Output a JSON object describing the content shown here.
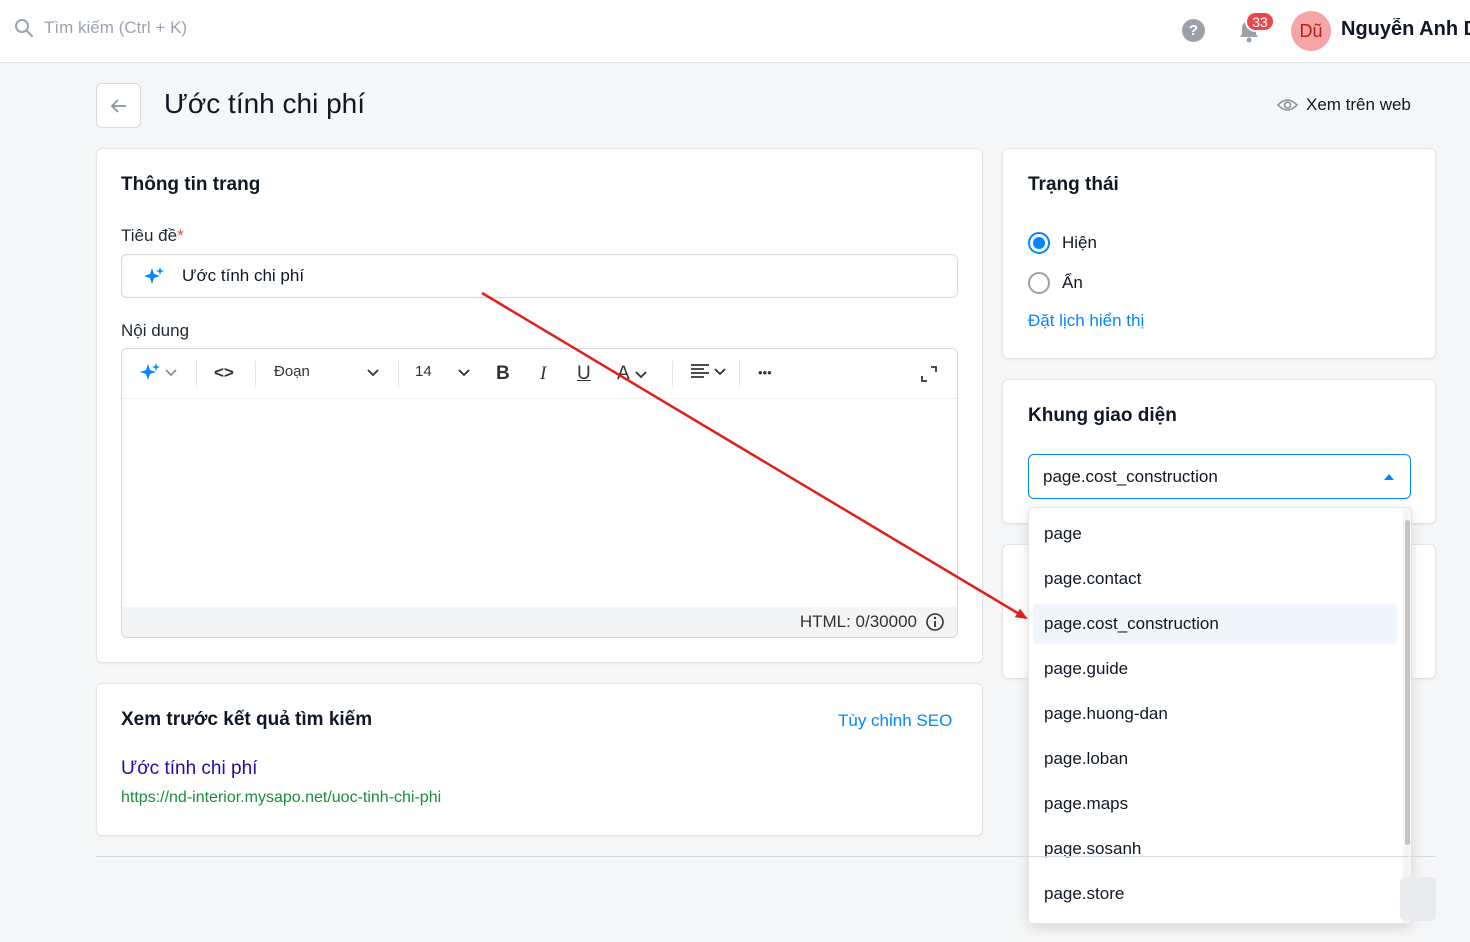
{
  "topbar": {
    "search_placeholder": "Tìm kiếm (Ctrl + K)",
    "help_icon": "?",
    "notification_count": "33",
    "avatar_initials": "Dũ",
    "user_name": "Nguyễn Anh Dũng"
  },
  "header": {
    "title": "Ước tính chi phí",
    "view_web_label": "Xem trên web"
  },
  "page_info": {
    "card_title": "Thông tin trang",
    "title_label": "Tiêu đề",
    "required_mark": "*",
    "title_value": "Ước tính chi phí",
    "content_label": "Nội dung",
    "toolbar": {
      "paragraph_label": "Đoạn",
      "font_size": "14",
      "bold": "B",
      "italic": "I",
      "underline": "U",
      "font_color": "A",
      "more": "•••",
      "code": "<>"
    },
    "html_counter": "HTML: 0/30000"
  },
  "seo": {
    "card_title": "Xem trước kết quả tìm kiếm",
    "customize_link": "Tùy chỉnh SEO",
    "preview_title": "Ước tính chi phí",
    "preview_url": "https://nd-interior.mysapo.net/uoc-tinh-chi-phi"
  },
  "status": {
    "card_title": "Trạng thái",
    "option_show": "Hiện",
    "option_hide": "Ẩn",
    "selected": "Hiện",
    "schedule_link": "Đặt lịch hiển thị"
  },
  "template": {
    "card_title": "Khung giao diện",
    "selected_value": "page.cost_construction",
    "options": [
      "page",
      "page.contact",
      "page.cost_construction",
      "page.guide",
      "page.huong-dan",
      "page.loban",
      "page.maps",
      "page.sosanh",
      "page.store"
    ]
  },
  "colors": {
    "accent": "#0088ff",
    "annotation_arrow": "#e0201b",
    "badge": "#e5484d"
  }
}
